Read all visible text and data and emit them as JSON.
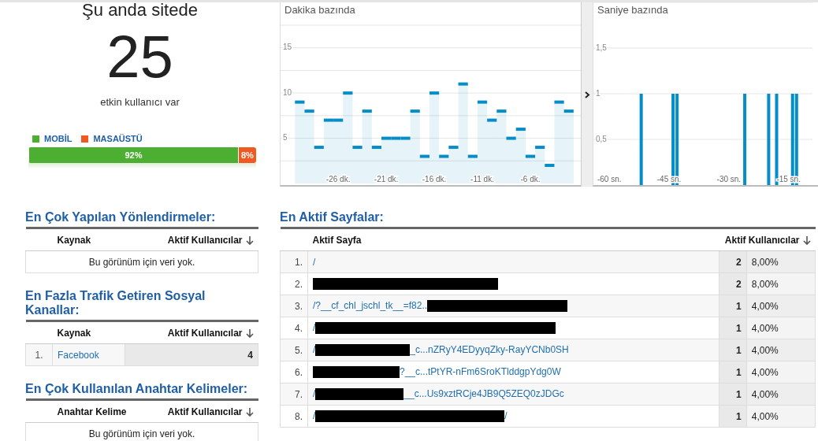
{
  "overview": {
    "title": "Şu anda sitede",
    "count": "25",
    "caption": "etkin kullanıcı var",
    "devices": [
      {
        "label": "MOBİL",
        "color": "#4caf32",
        "level": 0.92,
        "reading": "92%"
      },
      {
        "label": "MASAÜSTÜ",
        "color": "#f05a22",
        "level": 0.08,
        "reading": "8%"
      }
    ]
  },
  "minute_chart": {
    "title": "Dakika bazında",
    "chart_data": {
      "type": "bar",
      "grid": true,
      "xlim": [
        -32,
        -0.75
      ],
      "x": [
        -30,
        -29,
        -28,
        -27,
        -26,
        -25,
        -24,
        -23,
        -22,
        -21,
        -20,
        -19,
        -18,
        -17,
        -16,
        -15,
        -14,
        -13,
        -12,
        -11,
        -10,
        -9,
        -8,
        -7,
        -6,
        -5,
        -4,
        -3,
        -2
      ],
      "series": [
        {
          "color": "#058dc7",
          "values": [
            9,
            8,
            4,
            7,
            7,
            10,
            4,
            8,
            4,
            5,
            5,
            5,
            8,
            3,
            10,
            3,
            4,
            11,
            3,
            9,
            7,
            8,
            5,
            6,
            3,
            4,
            2,
            9,
            8
          ]
        }
      ],
      "ylim": [
        0,
        17.5
      ],
      "yticks": [
        5,
        10,
        15
      ],
      "xticks": [
        {
          "value": -26,
          "label": "-26 dk."
        },
        {
          "value": -21,
          "label": "-21 dk."
        },
        {
          "value": -16,
          "label": "-16 dk."
        },
        {
          "value": -11,
          "label": "-11 dk."
        },
        {
          "value": -6,
          "label": "-6 dk."
        }
      ]
    }
  },
  "second_chart": {
    "title": "Saniye bazında",
    "chart_data": {
      "type": "bar",
      "grid": true,
      "x": [
        -52,
        -44,
        -43,
        -26,
        -20,
        -18,
        -14,
        -13
      ],
      "series": [
        {
          "color": "#058dc7",
          "values": [
            1,
            1,
            1,
            1,
            1,
            1,
            1,
            1
          ]
        }
      ],
      "xlim": [
        -64,
        -9
      ],
      "ylim": [
        0,
        2
      ],
      "yticks": [
        {
          "value": 0.5,
          "label": "0,5"
        },
        {
          "value": 1,
          "label": "1"
        },
        {
          "value": 1.5,
          "label": "1,5"
        }
      ],
      "xticks": [
        {
          "value": -60,
          "label": "-60 sn."
        },
        {
          "value": -45,
          "label": "-45 sn."
        },
        {
          "value": -30,
          "label": "-30 sn."
        },
        {
          "value": -15,
          "label": "-15 sn."
        }
      ]
    }
  },
  "referrals": {
    "title": "En Çok Yapılan Yönlendirmeler:",
    "columns": [
      "Kaynak",
      "Aktif Kullanıcılar"
    ],
    "empty": "Bu görünüm için veri yok."
  },
  "social": {
    "title": "En Fazla Trafik Getiren Sosyal Kanallar:",
    "columns": [
      "Kaynak",
      "Aktif Kullanıcılar"
    ],
    "rows": [
      {
        "index": "1.",
        "source": "Facebook",
        "users": "4"
      }
    ]
  },
  "keywords": {
    "title": "En Çok Kullanılan Anahtar Kelimeler:",
    "columns": [
      "Anahtar Kelime",
      "Aktif Kullanıcılar"
    ],
    "empty": "Bu görünüm için veri yok."
  },
  "pages": {
    "title": "En Aktif Sayfalar:",
    "columns": [
      "Aktif Sayfa",
      "Aktif Kullanıcılar"
    ],
    "rows": [
      {
        "index": "1.",
        "parts": [
          {
            "kind": "text",
            "text": "/"
          }
        ],
        "users": "2",
        "share": "8,00%"
      },
      {
        "index": "2.",
        "parts": [
          {
            "kind": "redaction"
          }
        ],
        "users": "2",
        "share": "8,00%"
      },
      {
        "index": "3.",
        "parts": [
          {
            "kind": "text",
            "text": "/?__cf_chl_jschl_tk__=f82.."
          },
          {
            "kind": "redaction"
          }
        ],
        "users": "1",
        "share": "4,00%"
      },
      {
        "index": "4.",
        "parts": [
          {
            "kind": "text",
            "text": "/"
          },
          {
            "kind": "redaction"
          }
        ],
        "users": "1",
        "share": "4,00%"
      },
      {
        "index": "5.",
        "parts": [
          {
            "kind": "text",
            "text": "/"
          },
          {
            "kind": "redaction"
          },
          {
            "kind": "text",
            "text": "_c...nZRyY4EDyyqZky-RayYCNb0SH"
          }
        ],
        "users": "1",
        "share": "4,00%"
      },
      {
        "index": "6.",
        "parts": [
          {
            "kind": "redaction"
          },
          {
            "kind": "text",
            "text": "?__c...tPtYR-nFm6SroKTlddgpYdg0W"
          }
        ],
        "users": "1",
        "share": "4,00%"
      },
      {
        "index": "7.",
        "parts": [
          {
            "kind": "text",
            "text": "/"
          },
          {
            "kind": "redaction"
          },
          {
            "kind": "text",
            "text": "__c...Us9xztRCje4JB9Q5ZEQ0zJDGc"
          }
        ],
        "users": "1",
        "share": "4,00%"
      },
      {
        "index": "8.",
        "parts": [
          {
            "kind": "text",
            "text": "/"
          },
          {
            "kind": "redaction"
          },
          {
            "kind": "text",
            "text": "/"
          }
        ],
        "users": "1",
        "share": "4,00%"
      }
    ]
  }
}
